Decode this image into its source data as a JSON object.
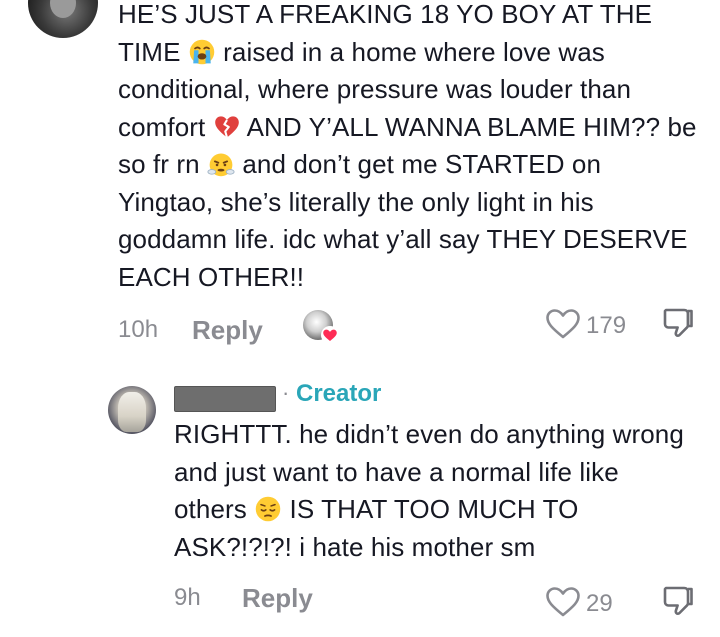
{
  "comment": {
    "segments": [
      {
        "type": "text",
        "value": "HE’S JUST A FREAKING 18 YO BOY AT THE TIME "
      },
      {
        "type": "emoji",
        "name": "loudly-crying-face-emoji"
      },
      {
        "type": "text",
        "value": " raised in a home where love was conditional, where pressure was louder than comfort "
      },
      {
        "type": "emoji",
        "name": "broken-heart-emoji"
      },
      {
        "type": "text",
        "value": " AND Y’ALL WANNA BLAME HIM?? be so fr rn "
      },
      {
        "type": "emoji",
        "name": "face-with-steam-emoji"
      },
      {
        "type": "text",
        "value": " and don’t get me STARTED on Yingtao, she’s literally the only light in his goddamn life. idc what y’all say THEY DESERVE EACH OTHER!!"
      }
    ],
    "time": "10h",
    "reply_label": "Reply",
    "like_count": "179",
    "liked_by_creator_icon": "creator-avatar-with-heart-icon"
  },
  "reply": {
    "author_label": "Creator",
    "separator": "·",
    "segments": [
      {
        "type": "text",
        "value": "RIGHTTT. he didn’t even do anything wrong and just want to have a normal life like others "
      },
      {
        "type": "emoji",
        "name": "pensive-face-emoji"
      },
      {
        "type": "text",
        "value": " IS THAT TOO MUCH TO ASK?!?!?! i hate his mother sm"
      }
    ],
    "time": "9h",
    "reply_label": "Reply",
    "like_count": "29"
  },
  "icons": {
    "like": "heart-outline-icon",
    "dislike": "thumbs-down-icon"
  },
  "colors": {
    "text": "#161823",
    "muted": "#8a8b91",
    "creator_accent": "#2aa6b8"
  }
}
